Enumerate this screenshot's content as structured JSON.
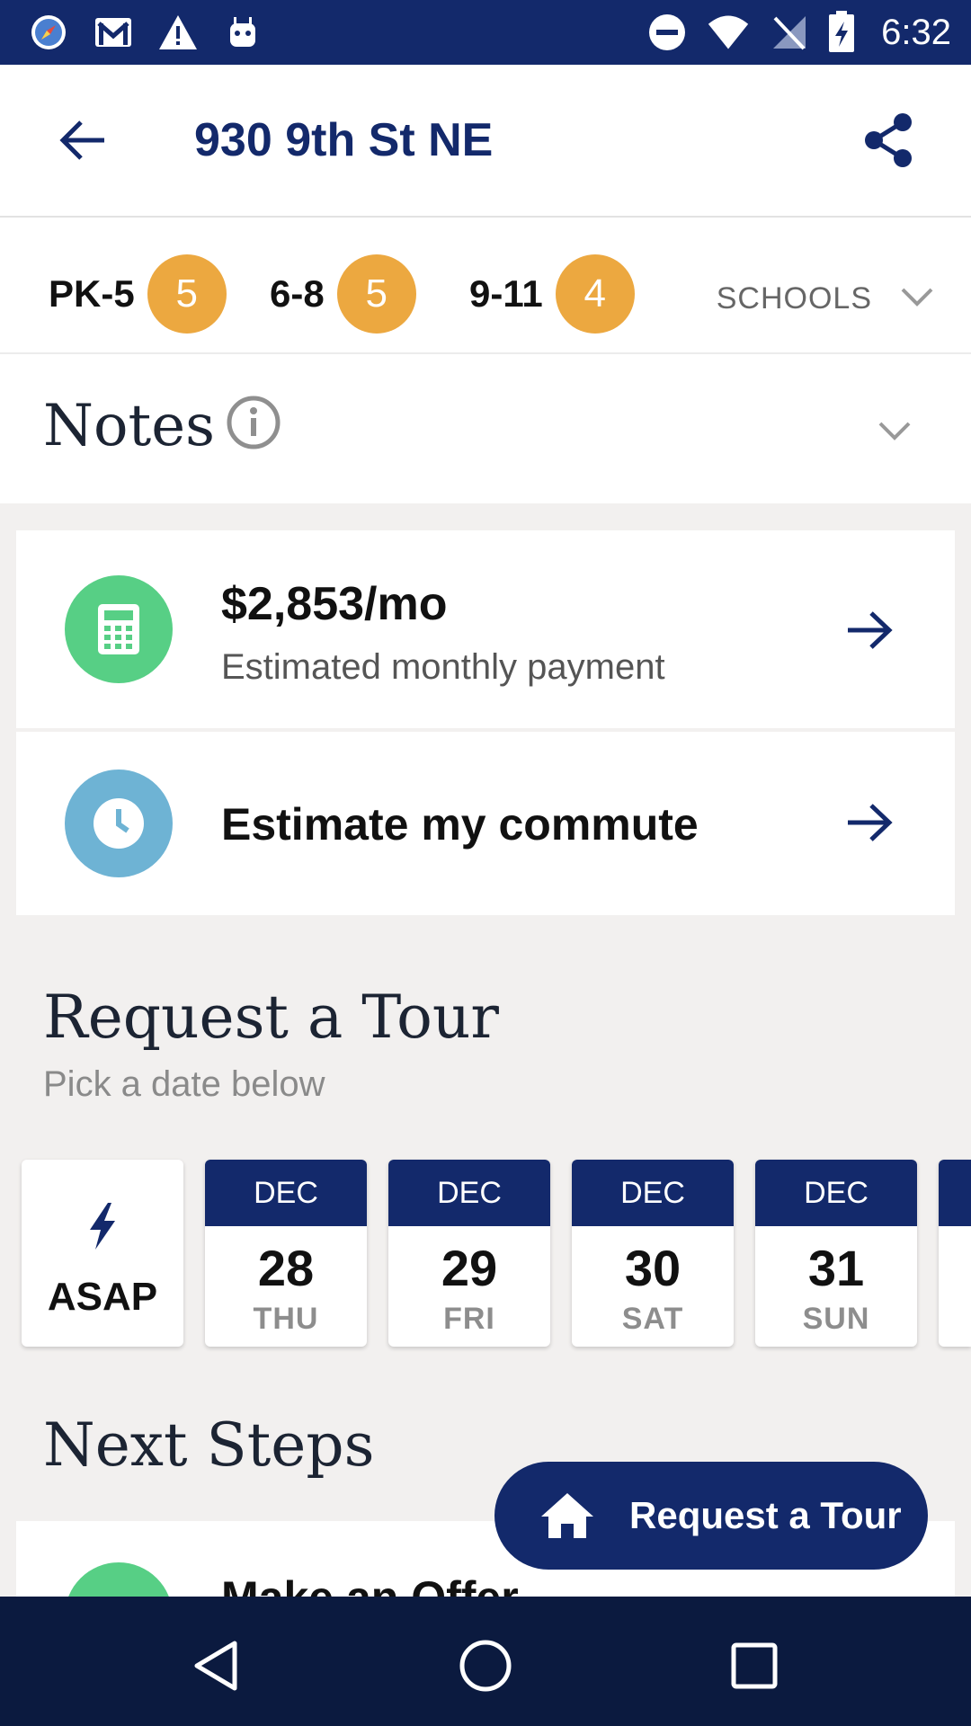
{
  "status_bar": {
    "time": "6:32",
    "left_icons": [
      "compass-icon",
      "gmail-icon",
      "warning-icon",
      "android-icon"
    ],
    "right_icons": [
      "do-not-disturb-icon",
      "wifi-icon",
      "no-signal-icon",
      "battery-charging-icon"
    ]
  },
  "app_bar": {
    "title": "930 9th St NE",
    "back_icon": "arrow-back-icon",
    "share_icon": "share-icon"
  },
  "schools": {
    "grades": [
      {
        "label": "PK-5",
        "rating": "5"
      },
      {
        "label": "6-8",
        "rating": "5"
      },
      {
        "label": "9-11",
        "rating": "4"
      }
    ],
    "toggle_label": "SCHOOLS"
  },
  "notes": {
    "title": "Notes"
  },
  "payment_card": {
    "amount": "$2,853/mo",
    "caption": "Estimated monthly payment"
  },
  "commute_card": {
    "label": "Estimate my commute"
  },
  "tour": {
    "title": "Request a Tour",
    "subtitle": "Pick a date below",
    "asap_label": "ASAP",
    "dates": [
      {
        "month": "DEC",
        "day": "28",
        "weekday": "THU"
      },
      {
        "month": "DEC",
        "day": "29",
        "weekday": "FRI"
      },
      {
        "month": "DEC",
        "day": "30",
        "weekday": "SAT"
      },
      {
        "month": "DEC",
        "day": "31",
        "weekday": "SUN"
      }
    ]
  },
  "next_steps": {
    "title": "Next Steps",
    "first_item": "Make an Offer"
  },
  "fab": {
    "label": "Request a Tour",
    "icon": "home-icon"
  },
  "colors": {
    "brand_navy": "#13296b",
    "badge_orange": "#eca840",
    "calculator_green": "#57cf85",
    "clock_blue": "#6eb3d4"
  }
}
